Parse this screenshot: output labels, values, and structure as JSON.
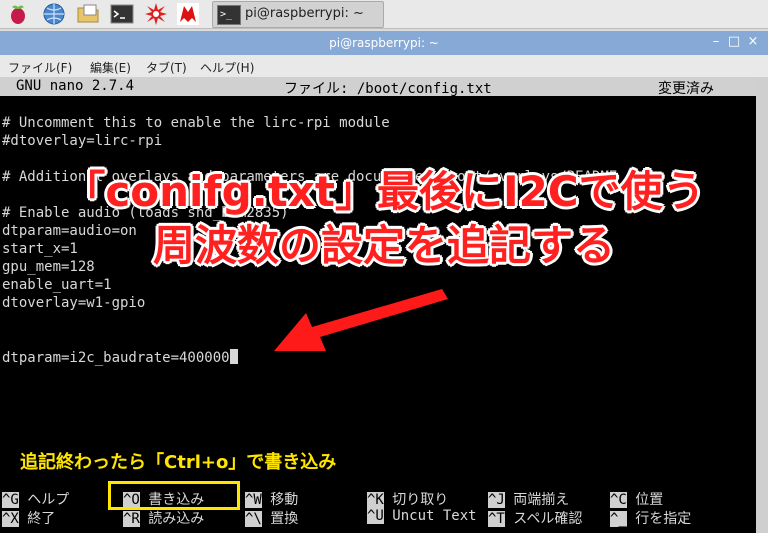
{
  "taskbar": {
    "icons": [
      "raspberry-icon",
      "globe-icon",
      "folder-icon",
      "terminal-icon",
      "burst-icon",
      "wolfram-icon"
    ],
    "task_label": "pi@raspberrypi: ~",
    "terminal_glyph": ">_"
  },
  "window": {
    "title": "pi@raspberrypi: ~",
    "controls": {
      "minimize": "–",
      "maximize": "□",
      "close": "×"
    }
  },
  "menu": [
    "ファイル(F)",
    "編集(E)",
    "タブ(T)",
    "ヘルプ(H)"
  ],
  "nano": {
    "version": "GNU nano 2.7.4",
    "file": "ファイル: /boot/config.txt",
    "status": "変更済み",
    "lines": [
      "# Uncomment this to enable the lirc-rpi module",
      "#dtoverlay=lirc-rpi",
      "",
      "# Additional overlays and parameters are documented /boot/overlays/README",
      "",
      "# Enable audio (loads snd_bcm2835)",
      "dtparam=audio=on",
      "start_x=1",
      "gpu_mem=128",
      "enable_uart=1",
      "dtoverlay=w1-gpio",
      "",
      "",
      "dtparam=i2c_baudrate=400000"
    ],
    "shortcuts_row1": [
      {
        "key": "^G",
        "label": "ヘルプ"
      },
      {
        "key": "^O",
        "label": "書き込み"
      },
      {
        "key": "^W",
        "label": "移動"
      },
      {
        "key": "^K",
        "label": "切り取り"
      },
      {
        "key": "^J",
        "label": "両端揃え"
      },
      {
        "key": "^C",
        "label": "位置"
      }
    ],
    "shortcuts_row2": [
      {
        "key": "^X",
        "label": "終了"
      },
      {
        "key": "^R",
        "label": "読み込み"
      },
      {
        "key": "^\\",
        "label": "置換"
      },
      {
        "key": "^U",
        "label": "Uncut Text"
      },
      {
        "key": "^T",
        "label": "スペル確認"
      },
      {
        "key": "^_",
        "label": "行を指定"
      }
    ]
  },
  "annotation": {
    "line1": "「conifg.txt」最後にI2Cで使う",
    "line2": "周波数の設定を追記する",
    "note": "追記終わったら「Ctrl+o」で書き込み",
    "red": "#ff2020",
    "yellow": "#ffe500"
  }
}
